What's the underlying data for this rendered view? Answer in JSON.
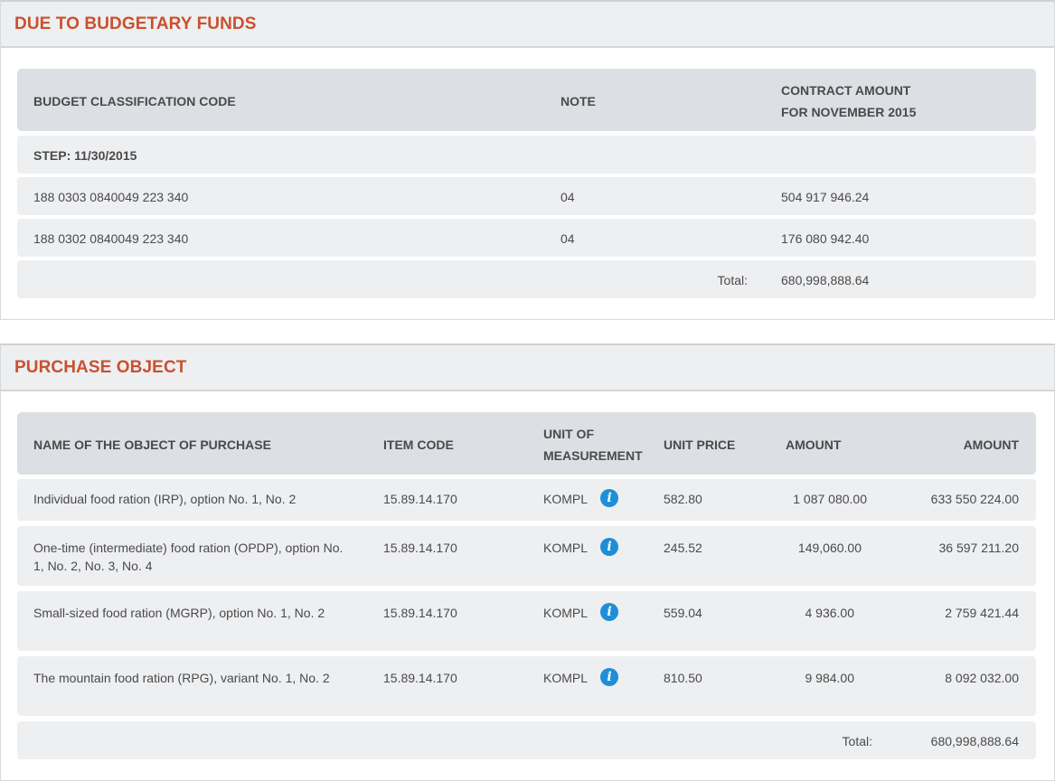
{
  "budget": {
    "title": "DUE TO BUDGETARY FUNDS",
    "headers": {
      "code": "BUDGET CLASSIFICATION CODE",
      "note": "NOTE",
      "amount_line1": "CONTRACT AMOUNT",
      "amount_line2": "FOR NOVEMBER 2015"
    },
    "step": "STEP: 11/30/2015",
    "rows": [
      {
        "code": "188 0303 0840049 223 340",
        "note": "04",
        "amount": "504 917 946.24"
      },
      {
        "code": "188 0302 0840049 223 340",
        "note": "04",
        "amount": "176 080 942.40"
      }
    ],
    "total_label": "Total:",
    "total_value": "680,998,888.64"
  },
  "purchase": {
    "title": "PURCHASE OBJECT",
    "headers": {
      "name": "NAME OF THE OBJECT OF PURCHASE",
      "item_code": "ITEM CODE",
      "unit_line1": "UNIT OF",
      "unit_line2": "MEASUREMENT",
      "unit_price": "UNIT PRICE",
      "amount1": "AMOUNT",
      "amount2": "AMOUNT"
    },
    "rows": [
      {
        "name": "Individual food ration (IRP), option No. 1, No. 2",
        "item_code": "15.89.14.170",
        "unit": "KOMPL",
        "unit_price": "582.80",
        "qty": "1 087 080.00",
        "amount": "633 550 224.00"
      },
      {
        "name": "One-time (intermediate) food ration (OPDP), option No. 1, No. 2, No. 3, No. 4",
        "item_code": "15.89.14.170",
        "unit": "KOMPL",
        "unit_price": "245.52",
        "qty": "149,060.00",
        "amount": "36 597 211.20"
      },
      {
        "name": "Small-sized food ration (MGRP), option No. 1, No. 2",
        "item_code": "15.89.14.170",
        "unit": "KOMPL",
        "unit_price": "559.04",
        "qty": "4 936.00",
        "amount": "2 759 421.44"
      },
      {
        "name": "The mountain food ration (RPG), variant No. 1, No. 2",
        "item_code": "15.89.14.170",
        "unit": "KOMPL",
        "unit_price": "810.50",
        "qty": "9 984.00",
        "amount": "8 092 032.00"
      }
    ],
    "info_icon_glyph": "i",
    "total_label": "Total:",
    "total_value": "680,998,888.64"
  },
  "colors": {
    "title": "#c9512e",
    "header_bg": "#dcdfe4",
    "row_bg": "#eeeff1",
    "info_icon": "#1e8fd6"
  }
}
